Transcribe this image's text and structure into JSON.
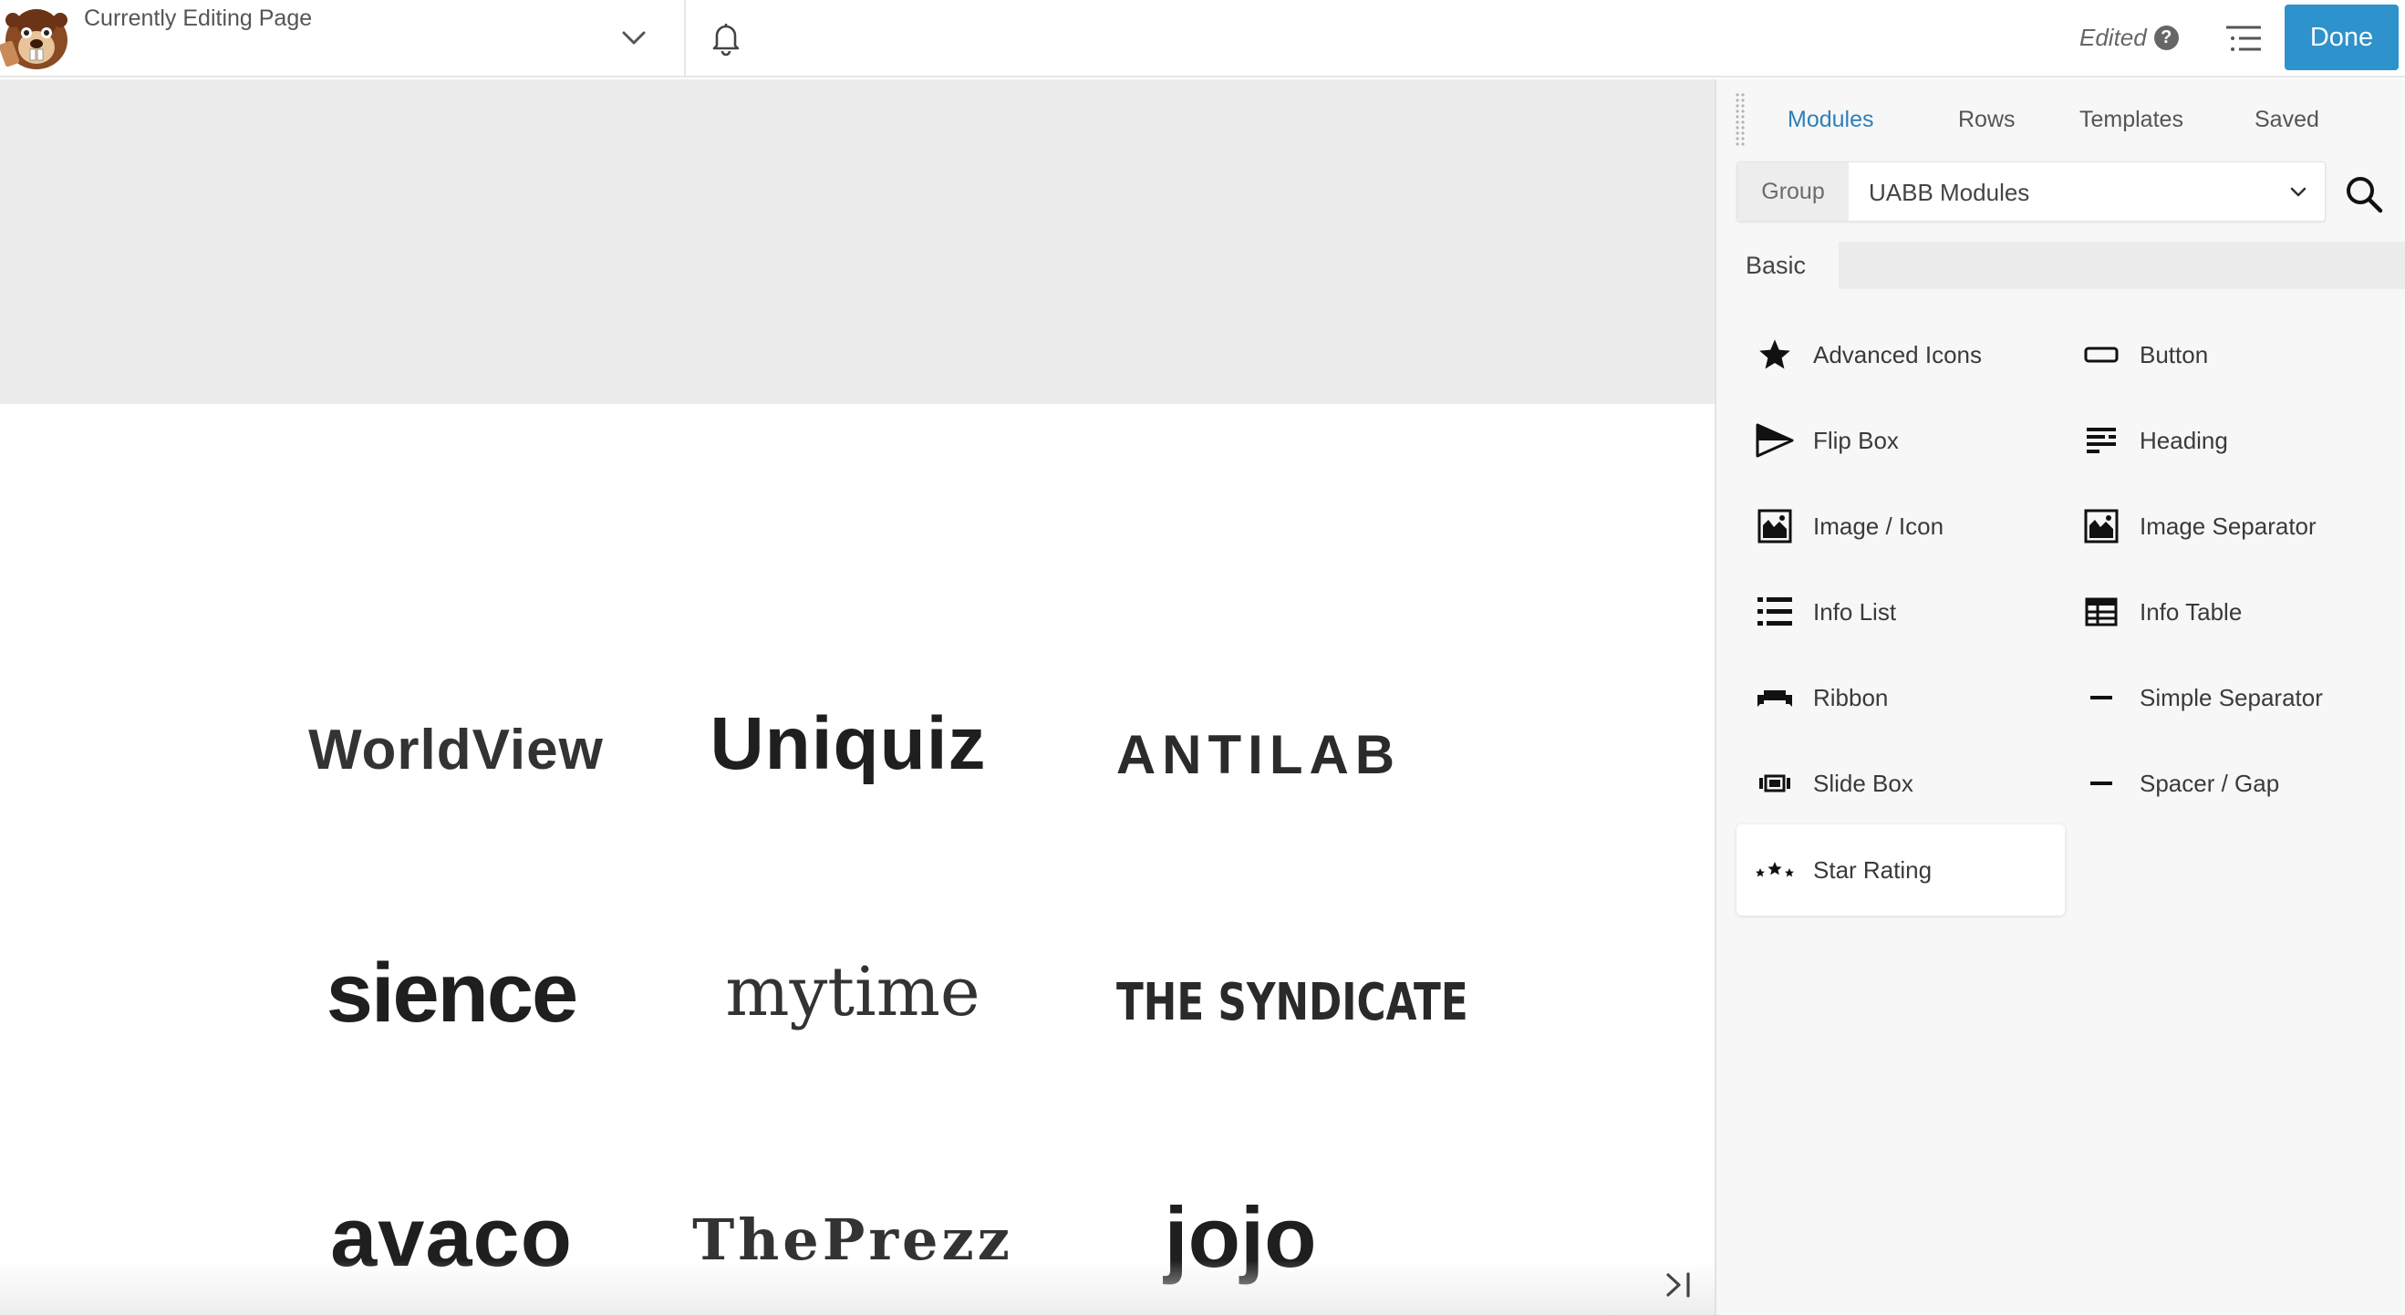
{
  "topbar": {
    "page_label": "Currently Editing Page",
    "edited_label": "Edited",
    "help_glyph": "?",
    "done_label": "Done",
    "accent_color": "#2e92cc"
  },
  "canvas": {
    "header_color": "#ececec",
    "logos": [
      "WorldView",
      "Uniquiz",
      "ANTILAB",
      "sience",
      "mytime",
      "THE SYNDICATE",
      "avaco",
      "ThePrezz",
      "jojo"
    ]
  },
  "panel": {
    "tabs": [
      {
        "label": "Modules",
        "active": true
      },
      {
        "label": "Rows",
        "active": false
      },
      {
        "label": "Templates",
        "active": false
      },
      {
        "label": "Saved",
        "active": false
      }
    ],
    "group": {
      "label": "Group",
      "value": "UABB Modules"
    },
    "section": "Basic",
    "modules": [
      {
        "label": "Advanced Icons",
        "icon": "star-icon"
      },
      {
        "label": "Button",
        "icon": "button-icon"
      },
      {
        "label": "Flip Box",
        "icon": "flip-box-icon"
      },
      {
        "label": "Heading",
        "icon": "heading-icon"
      },
      {
        "label": "Image / Icon",
        "icon": "image-icon"
      },
      {
        "label": "Image Separator",
        "icon": "image-icon"
      },
      {
        "label": "Info List",
        "icon": "list-icon"
      },
      {
        "label": "Info Table",
        "icon": "table-icon"
      },
      {
        "label": "Ribbon",
        "icon": "ribbon-icon"
      },
      {
        "label": "Simple Separator",
        "icon": "separator-icon"
      },
      {
        "label": "Slide Box",
        "icon": "slide-box-icon"
      },
      {
        "label": "Spacer / Gap",
        "icon": "spacer-icon"
      },
      {
        "label": "Star Rating",
        "icon": "star-rating-icon",
        "hovered": true
      }
    ]
  }
}
